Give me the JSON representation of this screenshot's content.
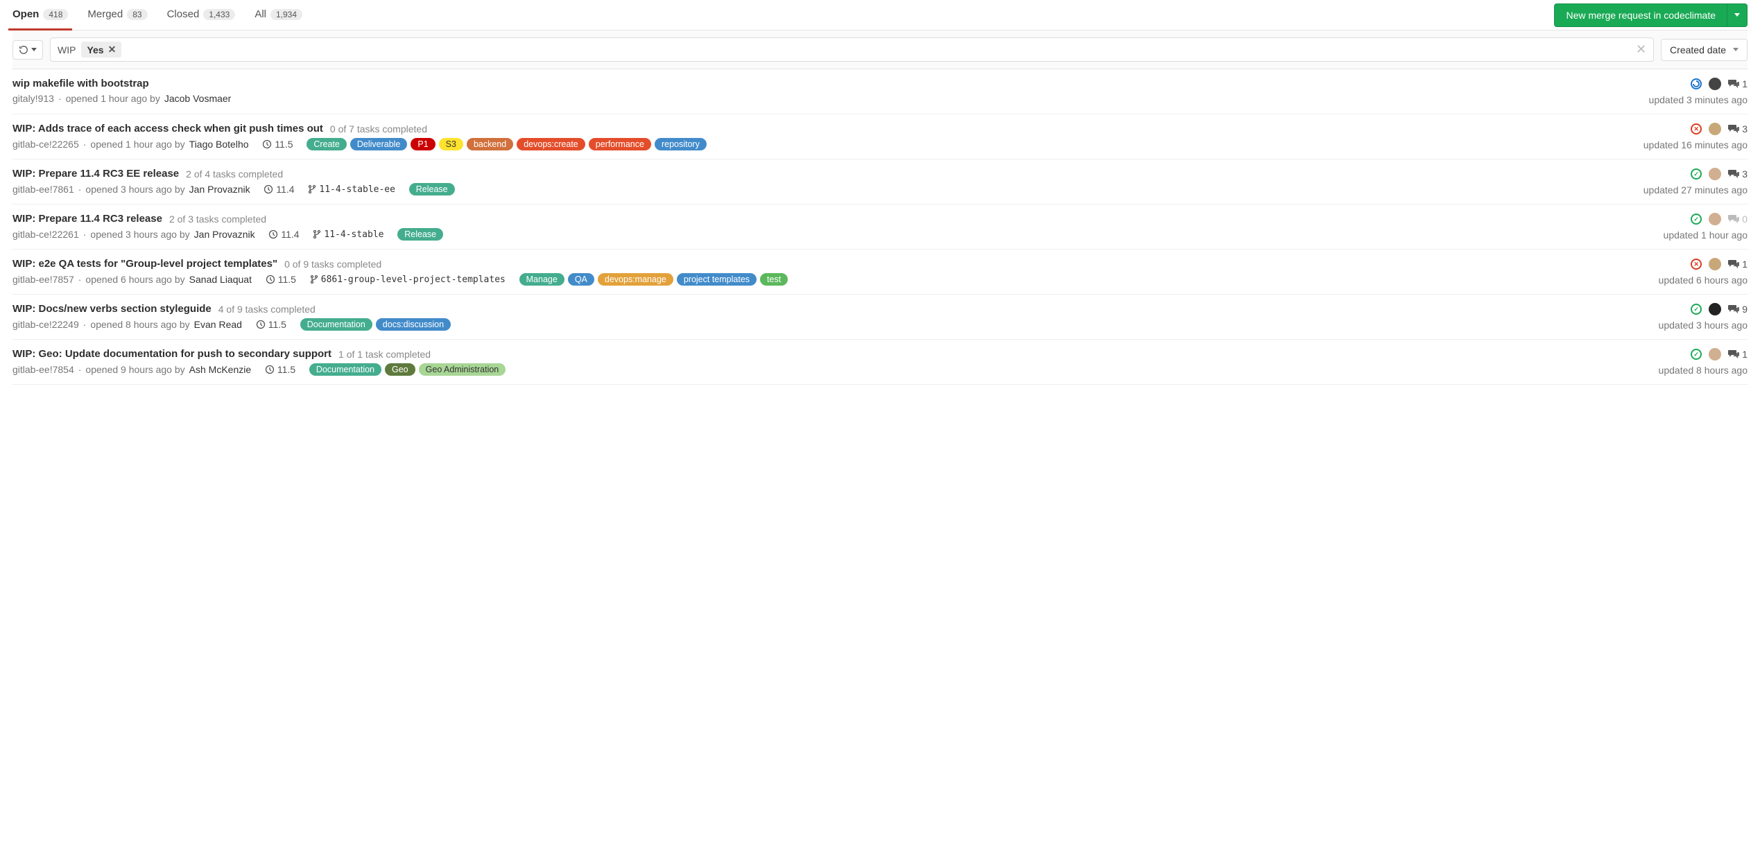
{
  "tabs": {
    "open": {
      "label": "Open",
      "count": "418"
    },
    "merged": {
      "label": "Merged",
      "count": "83"
    },
    "closed": {
      "label": "Closed",
      "count": "1,433"
    },
    "all": {
      "label": "All",
      "count": "1,934"
    }
  },
  "new_mr_button": "New merge request in codeclimate",
  "filter": {
    "key": "WIP",
    "value": "Yes"
  },
  "sort": "Created date",
  "rows": [
    {
      "title": "wip makefile with bootstrap",
      "tasks": "",
      "ref": "gitaly!913",
      "opened": "opened 1 hour ago by",
      "author": "Jacob Vosmaer",
      "milestone": "",
      "branch": "",
      "labels": [],
      "pipeline": "running",
      "avatar": "#444",
      "comments": "1",
      "comments_muted": false,
      "updated": "updated 3 minutes ago"
    },
    {
      "title": "WIP: Adds trace of each access check when git push times out",
      "tasks": "0 of 7 tasks completed",
      "ref": "gitlab-ce!22265",
      "opened": "opened 1 hour ago by",
      "author": "Tiago Botelho",
      "milestone": "11.5",
      "branch": "",
      "labels": [
        {
          "text": "Create",
          "bg": "#44ad8e"
        },
        {
          "text": "Deliverable",
          "bg": "#428bca"
        },
        {
          "text": "P1",
          "bg": "#cc0000"
        },
        {
          "text": "S3",
          "bg": "#fee22e",
          "fg": "#333"
        },
        {
          "text": "backend",
          "bg": "#d1703c"
        },
        {
          "text": "devops:create",
          "bg": "#e44d2a"
        },
        {
          "text": "performance",
          "bg": "#e44d2a"
        },
        {
          "text": "repository",
          "bg": "#428bca"
        }
      ],
      "pipeline": "failed",
      "avatar": "#c8a878",
      "comments": "3",
      "comments_muted": false,
      "updated": "updated 16 minutes ago"
    },
    {
      "title": "WIP: Prepare 11.4 RC3 EE release",
      "tasks": "2 of 4 tasks completed",
      "ref": "gitlab-ee!7861",
      "opened": "opened 3 hours ago by",
      "author": "Jan Provaznik",
      "milestone": "11.4",
      "branch": "11-4-stable-ee",
      "labels": [
        {
          "text": "Release",
          "bg": "#44ad8e"
        }
      ],
      "pipeline": "passed",
      "avatar": "#d0b090",
      "comments": "3",
      "comments_muted": false,
      "updated": "updated 27 minutes ago"
    },
    {
      "title": "WIP: Prepare 11.4 RC3 release",
      "tasks": "2 of 3 tasks completed",
      "ref": "gitlab-ce!22261",
      "opened": "opened 3 hours ago by",
      "author": "Jan Provaznik",
      "milestone": "11.4",
      "branch": "11-4-stable",
      "labels": [
        {
          "text": "Release",
          "bg": "#44ad8e"
        }
      ],
      "pipeline": "passed",
      "avatar": "#d0b090",
      "comments": "0",
      "comments_muted": true,
      "updated": "updated 1 hour ago"
    },
    {
      "title": "WIP: e2e QA tests for \"Group-level project templates\"",
      "tasks": "0 of 9 tasks completed",
      "ref": "gitlab-ee!7857",
      "opened": "opened 6 hours ago by",
      "author": "Sanad Liaquat",
      "milestone": "11.5",
      "branch": "6861-group-level-project-templates",
      "labels": [
        {
          "text": "Manage",
          "bg": "#44ad8e"
        },
        {
          "text": "QA",
          "bg": "#428bca"
        },
        {
          "text": "devops:manage",
          "bg": "#e3a13a"
        },
        {
          "text": "project templates",
          "bg": "#428bca"
        },
        {
          "text": "test",
          "bg": "#5cb85c"
        }
      ],
      "labels_wrap_last": true,
      "pipeline": "failed",
      "avatar": "#c8a878",
      "comments": "1",
      "comments_muted": false,
      "updated": "updated 6 hours ago"
    },
    {
      "title": "WIP: Docs/new verbs section styleguide",
      "tasks": "4 of 9 tasks completed",
      "ref": "gitlab-ce!22249",
      "opened": "opened 8 hours ago by",
      "author": "Evan Read",
      "milestone": "11.5",
      "branch": "",
      "labels": [
        {
          "text": "Documentation",
          "bg": "#44ad8e"
        },
        {
          "text": "docs:discussion",
          "bg": "#428bca"
        }
      ],
      "pipeline": "passed",
      "avatar": "#222",
      "comments": "9",
      "comments_muted": false,
      "updated": "updated 3 hours ago"
    },
    {
      "title": "WIP: Geo: Update documentation for push to secondary support",
      "tasks": "1 of 1 task completed",
      "ref": "gitlab-ee!7854",
      "opened": "opened 9 hours ago by",
      "author": "Ash McKenzie",
      "milestone": "11.5",
      "branch": "",
      "labels": [
        {
          "text": "Documentation",
          "bg": "#44ad8e"
        },
        {
          "text": "Geo",
          "bg": "#5e7a3c"
        },
        {
          "text": "Geo Administration",
          "bg": "#a8d695",
          "fg": "#333"
        }
      ],
      "pipeline": "passed",
      "avatar": "#d0b090",
      "comments": "1",
      "comments_muted": false,
      "updated": "updated 8 hours ago"
    }
  ]
}
